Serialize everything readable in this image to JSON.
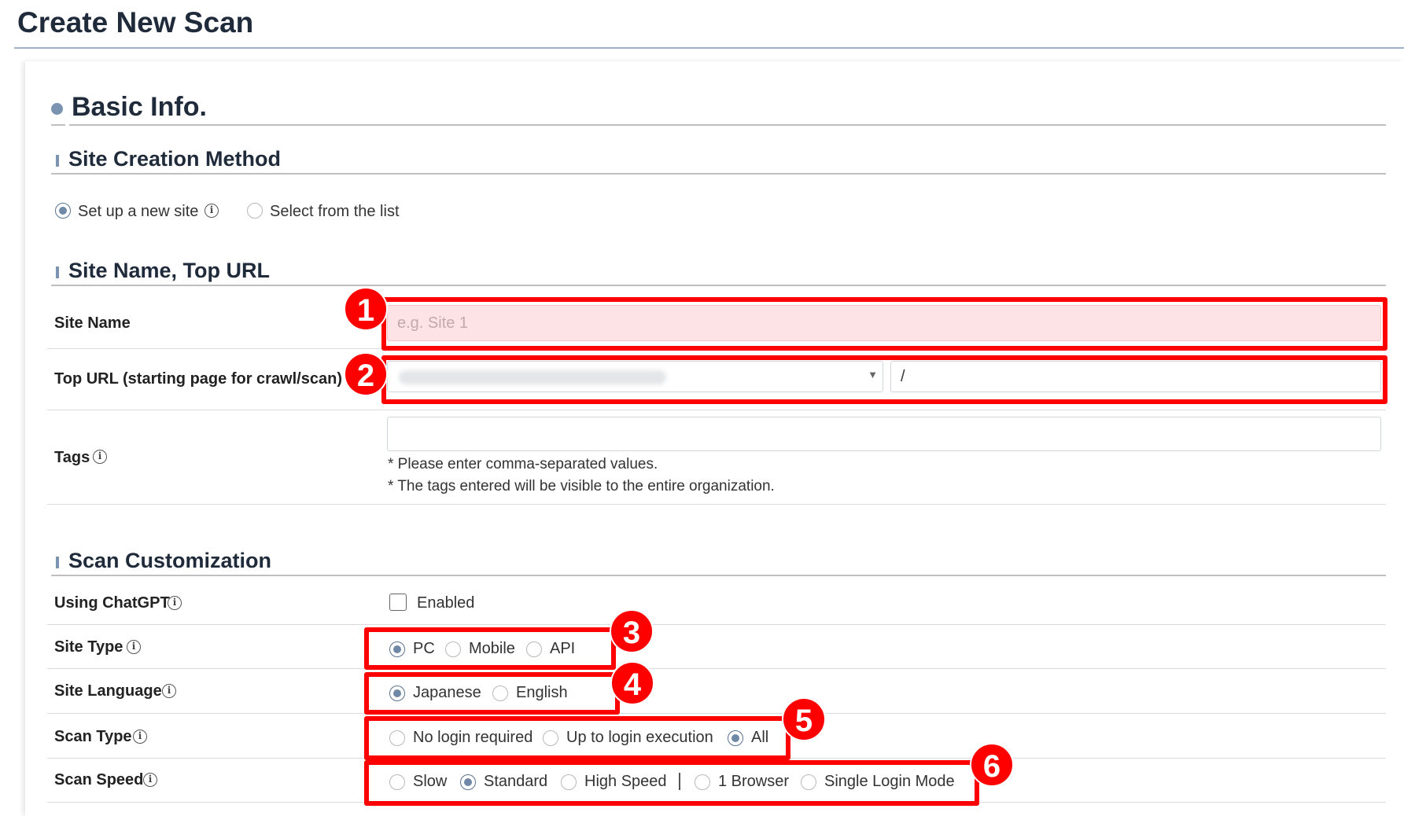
{
  "page": {
    "title": "Create New Scan"
  },
  "basic_info": {
    "heading": "Basic Info.",
    "site_creation_method": {
      "heading": "Site Creation Method",
      "options": [
        {
          "label": "Set up a new site",
          "selected": true
        },
        {
          "label": "Select from the list",
          "selected": false
        }
      ]
    },
    "site_name_top_url": {
      "heading": "Site Name, Top URL",
      "site_name": {
        "label": "Site Name",
        "placeholder": "e.g. Site 1",
        "value": ""
      },
      "top_url": {
        "label": "Top URL (starting page for crawl/scan)",
        "path_value": "/"
      },
      "tags": {
        "label": "Tags",
        "value": "",
        "note1": "* Please enter comma-separated values.",
        "note2": "* The tags entered will be visible to the entire organization."
      }
    }
  },
  "scan_customization": {
    "heading": "Scan Customization",
    "using_chatgpt": {
      "label": "Using ChatGPT",
      "checkbox_label": "Enabled",
      "checked": false
    },
    "site_type": {
      "label": "Site Type",
      "options": [
        "PC",
        "Mobile",
        "API"
      ],
      "selected": "PC"
    },
    "site_language": {
      "label": "Site Language",
      "options": [
        "Japanese",
        "English"
      ],
      "selected": "Japanese"
    },
    "scan_type": {
      "label": "Scan Type",
      "options": [
        "No login required",
        "Up to login execution",
        "All"
      ],
      "selected": "All"
    },
    "scan_speed": {
      "label": "Scan Speed",
      "options": [
        "Slow",
        "Standard",
        "High Speed"
      ],
      "selected": "Standard",
      "mode_options": [
        "1 Browser",
        "Single Login Mode"
      ]
    }
  },
  "annotations": [
    "1",
    "2",
    "3",
    "4",
    "5",
    "6"
  ],
  "colors": {
    "highlight": "#ff0000",
    "accent": "#6f88a6",
    "error_bg": "#fde3e5"
  }
}
